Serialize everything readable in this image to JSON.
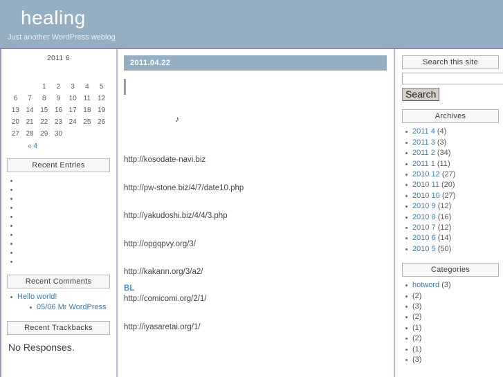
{
  "header": {
    "title": "healing",
    "tagline": "Just another WordPress weblog"
  },
  "calendar": {
    "caption": "2011  6",
    "weekday_headers": [
      "",
      "",
      "",
      "",
      "",
      "",
      ""
    ],
    "weeks": [
      [
        "",
        "",
        "1",
        "2",
        "3",
        "4",
        "5"
      ],
      [
        "6",
        "7",
        "8",
        "9",
        "10",
        "11",
        "12"
      ],
      [
        "13",
        "14",
        "15",
        "16",
        "17",
        "18",
        "19"
      ],
      [
        "20",
        "21",
        "22",
        "23",
        "24",
        "25",
        "26"
      ],
      [
        "27",
        "28",
        "29",
        "30",
        "",
        "",
        ""
      ]
    ],
    "prev_link": "« 4"
  },
  "recent_entries": {
    "title": "Recent Entries",
    "items": [
      "",
      "",
      "",
      "",
      "",
      "",
      "",
      "",
      "",
      ""
    ]
  },
  "recent_comments": {
    "title": "Recent Comments",
    "items": [
      {
        "label": "Hello world!",
        "child": "05/06 Mr WordPress"
      }
    ]
  },
  "recent_trackbacks": {
    "title": "Recent Trackbacks",
    "empty_text": "No Responses."
  },
  "post": {
    "date": "2011.04.22",
    "music_note": "♪",
    "links": [
      {
        "text": "http://kosodate-navi.biz"
      },
      {
        "text": "http://pw-stone.biz/4/7/date10.php"
      },
      {
        "text": "http://yakudoshi.biz/4/4/3.php"
      },
      {
        "text": "http://opgqpvy.org/3/"
      },
      {
        "text": "http://kakann.org/3/a2/"
      },
      {
        "label": "BL",
        "text": "http://comicomi.org/2/1/"
      },
      {
        "text": "http://iyasaretai.org/1/"
      }
    ]
  },
  "search": {
    "title": "Search this site",
    "value": "",
    "placeholder": "",
    "button_label": "Search"
  },
  "archives": {
    "title": "Archives",
    "items": [
      {
        "label": "2011 4",
        "count": "(4)"
      },
      {
        "label": "2011 3",
        "count": "(3)"
      },
      {
        "label": "2011 2",
        "count": "(34)"
      },
      {
        "label": "2011 1",
        "count": "(11)"
      },
      {
        "label": "2010 12",
        "count": "(27)"
      },
      {
        "label": "2010 11",
        "count": "(20)"
      },
      {
        "label": "2010 10",
        "count": "(27)"
      },
      {
        "label": "2010 9",
        "count": "(12)"
      },
      {
        "label": "2010 8",
        "count": "(16)"
      },
      {
        "label": "2010 7",
        "count": "(12)"
      },
      {
        "label": "2010 6",
        "count": "(14)"
      },
      {
        "label": "2010 5",
        "count": "(50)"
      }
    ]
  },
  "categories": {
    "title": "Categories",
    "items": [
      {
        "label": "hotword",
        "count": "(3)",
        "indent": 0
      },
      {
        "label": "",
        "count": "(2)",
        "indent": 1
      },
      {
        "label": "",
        "count": "(3)",
        "indent": 1
      },
      {
        "label": "",
        "count": "(2)",
        "indent": 2
      },
      {
        "label": "",
        "count": "(1)",
        "indent": 2
      },
      {
        "label": "",
        "count": "(2)",
        "indent": 1
      },
      {
        "label": "",
        "count": "(1)",
        "indent": 3
      },
      {
        "label": "",
        "count": "(3)",
        "indent": 1
      }
    ]
  }
}
